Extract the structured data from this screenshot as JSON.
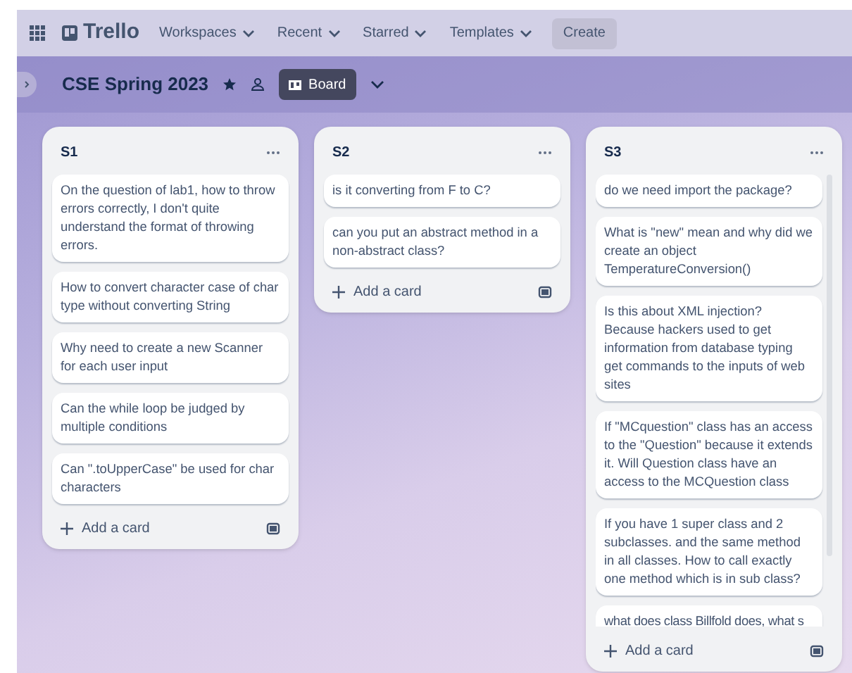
{
  "topbar": {
    "logo": "Trello",
    "menus": [
      {
        "label": "Workspaces"
      },
      {
        "label": "Recent"
      },
      {
        "label": "Starred"
      },
      {
        "label": "Templates"
      }
    ],
    "create": "Create"
  },
  "board": {
    "title": "CSE Spring 2023",
    "view": "Board"
  },
  "lists": [
    {
      "title": "S1",
      "cards": [
        "On the question of lab1, how to throw errors correctly, I don't quite understand the format of throwing errors.",
        "How to convert character case of char type without converting String",
        "Why need to create a new Scanner for each user input",
        "Can the while loop be judged by multiple conditions",
        "Can \".toUpperCase\" be used for char characters"
      ],
      "add_label": "Add a card"
    },
    {
      "title": "S2",
      "cards": [
        "is it converting from F to C?",
        "can you put an abstract method in a non-abstract class?"
      ],
      "add_label": "Add a card"
    },
    {
      "title": "S3",
      "cards": [
        "do we need import the package?",
        "What is \"new\" mean and why did we create an object TemperatureConversion()",
        "Is this about XML injection? Because hackers used to get information from database typing get commands to the inputs of web sites",
        "If \"MCquestion\" class has an access to the \"Question\" because it extends it. Will Question class have an access to the MCQuestion class",
        "If you have 1 super class and 2 subclasses. and the same method in all classes. How to call exactly one method which is in sub class?",
        "what does class Billfold does, what s"
      ],
      "add_label": "Add a card"
    }
  ]
}
